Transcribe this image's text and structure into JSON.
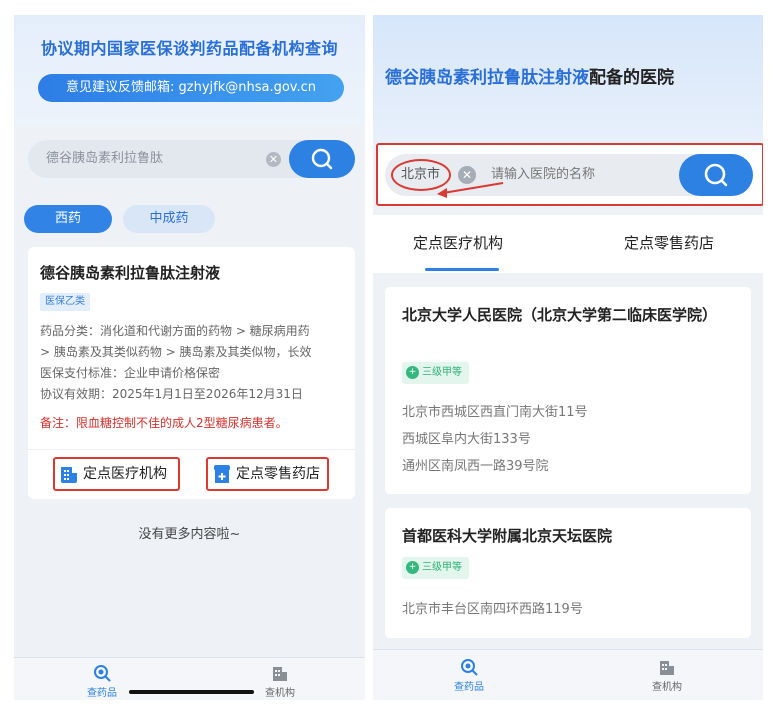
{
  "left": {
    "header": {
      "title": "协议期内国家医保谈判药品配备机构查询",
      "feedback_email": "意见建议反馈邮箱: gzhyjfk@nhsa.gov.cn"
    },
    "search": {
      "value": "德谷胰岛素利拉鲁肽"
    },
    "tabs": [
      {
        "label": "西药",
        "active": true
      },
      {
        "label": "中成药",
        "active": false
      }
    ],
    "drug_card": {
      "name": "德谷胰岛素利拉鲁肽注射液",
      "tag": "医保乙类",
      "category_line1": "药品分类：消化道和代谢方面的药物 > 糖尿病用药",
      "category_line2": "> 胰岛素及其类似药物 > 胰岛素及其类似物，长效",
      "payment_standard": "医保支付标准：企业申请价格保密",
      "validity": "协议有效期：2025年1月1日至2026年12月31日",
      "note": "备注：限血糖控制不佳的成人2型糖尿病患者。",
      "buttons": {
        "medical_institution": "定点医疗机构",
        "retail_pharmacy": "定点零售药店"
      }
    },
    "no_more": "没有更多内容啦~",
    "tabbar": [
      {
        "label": "查药品",
        "icon": "search-drug-icon",
        "active": true
      },
      {
        "label": "查机构",
        "icon": "building-icon",
        "active": false
      }
    ]
  },
  "right": {
    "header": {
      "title_highlight": "德谷胰岛素利拉鲁肽注射液",
      "title_rest": "配备的医院"
    },
    "search": {
      "city": "北京市",
      "placeholder": "请输入医院的名称"
    },
    "tabs": [
      {
        "label": "定点医疗机构",
        "active": true
      },
      {
        "label": "定点零售药店",
        "active": false
      }
    ],
    "hospitals": [
      {
        "name": "北京大学人民医院（北京大学第二临床医学院）",
        "level": "三级甲等",
        "addresses": [
          "北京市西城区西直门南大街11号",
          "西城区阜内大街133号",
          "通州区南凤西一路39号院"
        ]
      },
      {
        "name": "首都医科大学附属北京天坛医院",
        "level": "三级甲等",
        "addresses": [
          "北京市丰台区南四环西路119号"
        ]
      }
    ],
    "tabbar": [
      {
        "label": "查药品",
        "icon": "search-drug-icon",
        "active": true
      },
      {
        "label": "查机构",
        "icon": "building-icon",
        "active": false
      }
    ]
  },
  "colors": {
    "primary": "#2d81e3",
    "title_blue": "#2a6fd6",
    "annotation_red": "#d93a33",
    "level_green": "#2fb074"
  }
}
